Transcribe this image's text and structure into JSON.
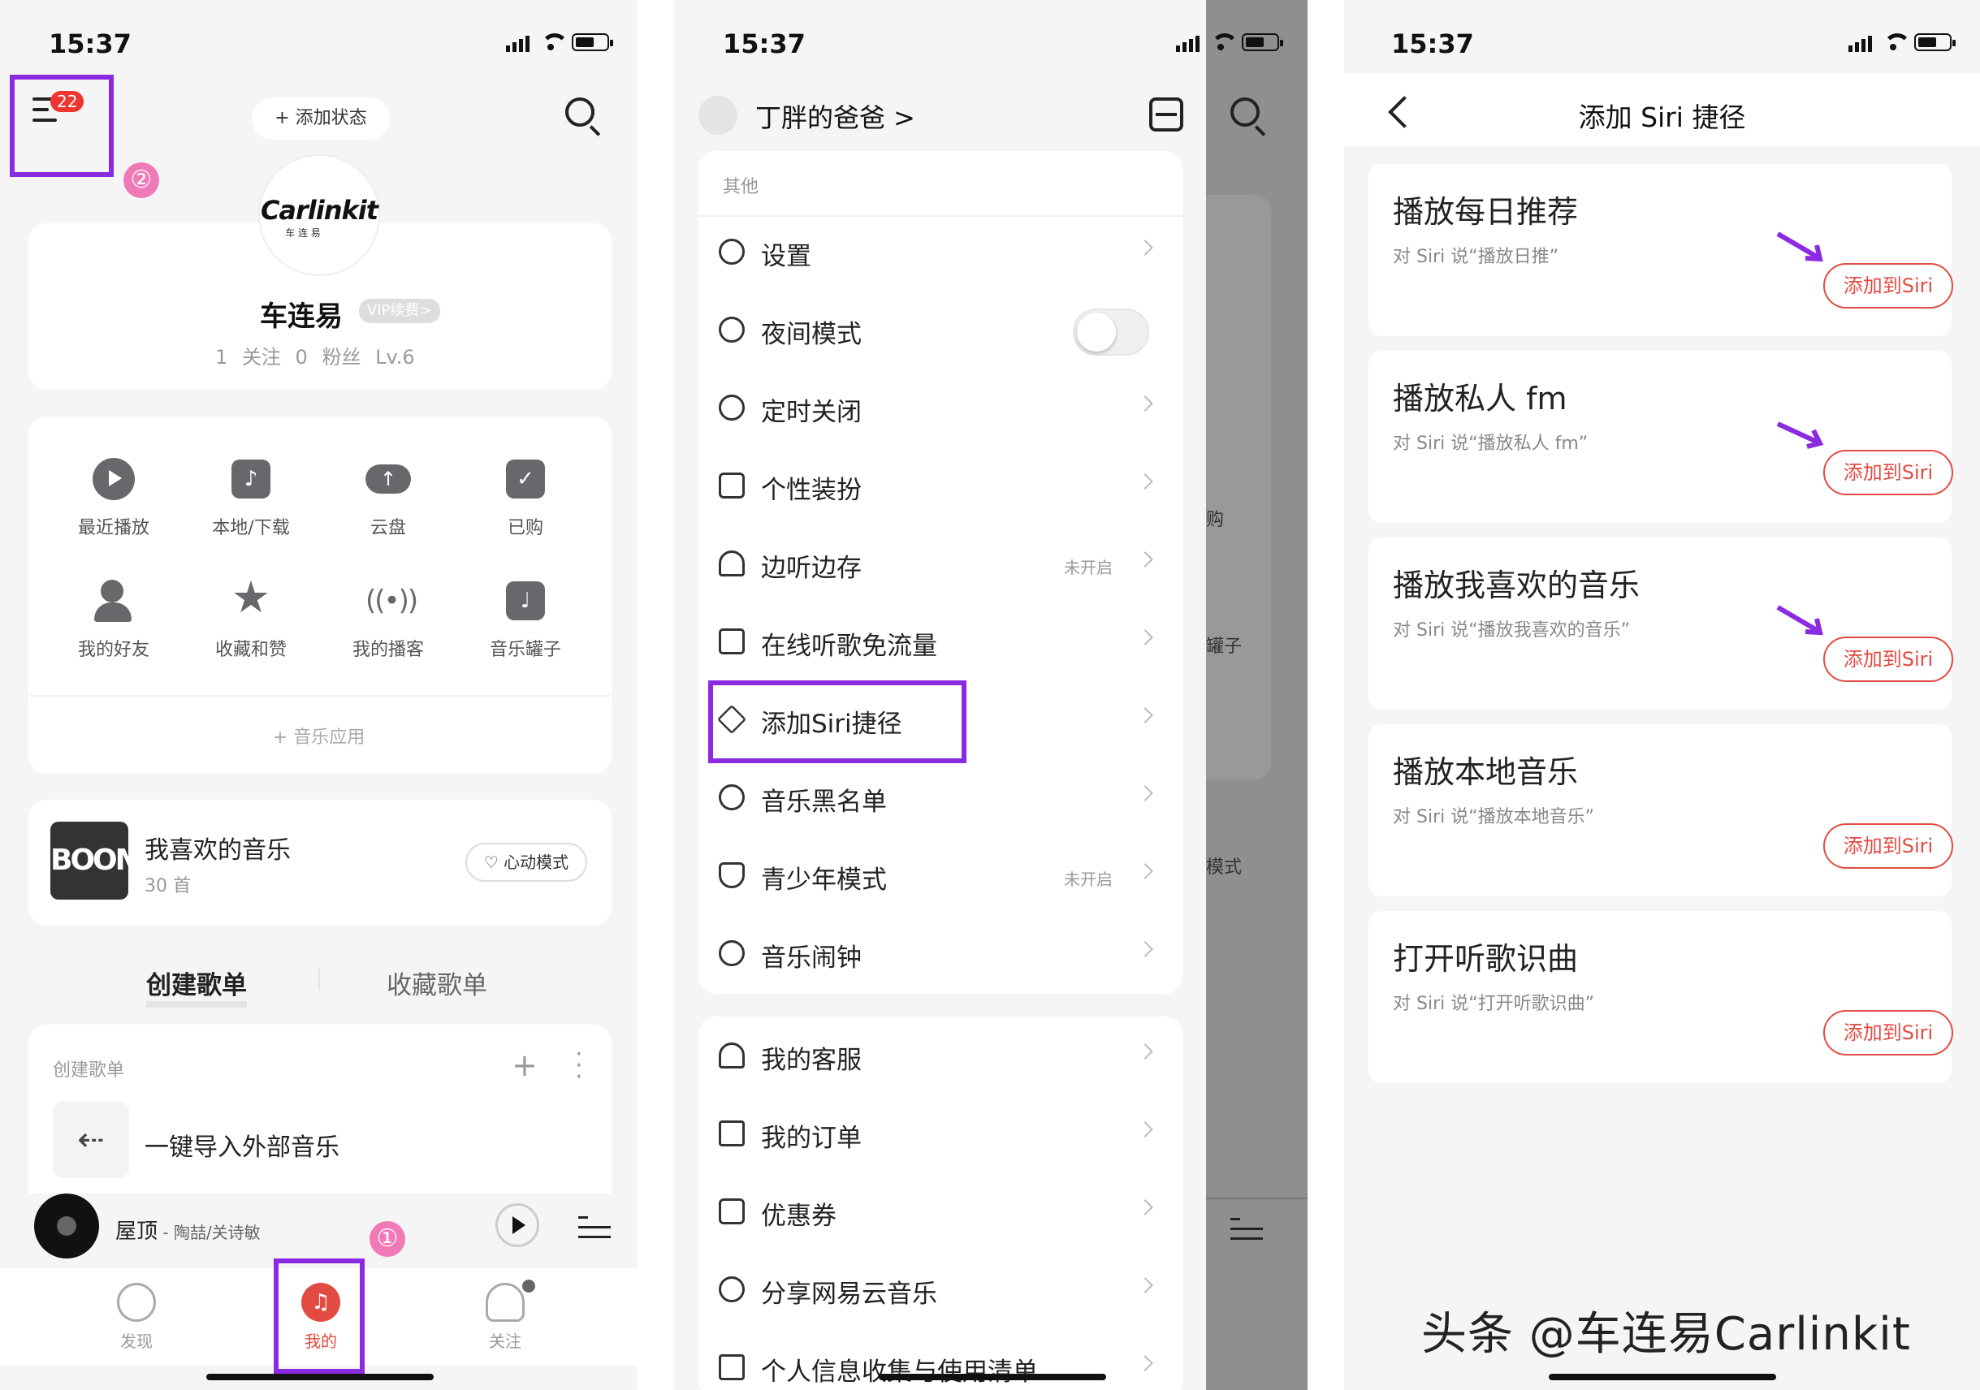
{
  "status": {
    "time": "15:37"
  },
  "panel1": {
    "badge": "22",
    "add_status": "+ 添加状态",
    "profile": {
      "name": "车连易",
      "vip": "VIP续费>",
      "follows": "1 关注",
      "fans": "0 粉丝",
      "level": "Lv.6",
      "logo_main": "Carlinkit",
      "logo_sub": "车 连 易"
    },
    "quick_items": [
      {
        "label": "最近播放",
        "icon": "play-icon"
      },
      {
        "label": "本地/下载",
        "icon": "music-note-icon"
      },
      {
        "label": "云盘",
        "icon": "cloud-upload-icon"
      },
      {
        "label": "已购",
        "icon": "shopping-bag-icon"
      },
      {
        "label": "我的好友",
        "icon": "friends-icon"
      },
      {
        "label": "收藏和赞",
        "icon": "star-icon"
      },
      {
        "label": "我的播客",
        "icon": "podcast-icon"
      },
      {
        "label": "音乐罐子",
        "icon": "jar-icon"
      }
    ],
    "music_apps": "+ 音乐应用",
    "liked": {
      "title": "我喜欢的音乐",
      "count": "30 首",
      "heart_mode": "心动模式",
      "cover_text": "BOOM"
    },
    "tabs": [
      "创建歌单",
      "收藏歌单"
    ],
    "playlist_section": "创建歌单",
    "import_label": "一键导入外部音乐",
    "now_playing": {
      "song": "屋顶",
      "artist": " - 陶喆/关诗敏"
    },
    "nav": [
      "发现",
      "我的",
      "关注"
    ],
    "marker_menu": "②",
    "marker_nav": "①"
  },
  "panel2": {
    "user": "丁胖的爸爸 >",
    "section_other": "其他",
    "menu": [
      {
        "label": "设置",
        "icon": "settings-icon",
        "value": ""
      },
      {
        "label": "夜间模式",
        "icon": "moon-icon",
        "value": "",
        "toggle": true
      },
      {
        "label": "定时关闭",
        "icon": "timer-icon",
        "value": ""
      },
      {
        "label": "个性装扮",
        "icon": "tshirt-icon",
        "value": ""
      },
      {
        "label": "边听边存",
        "icon": "headphones-icon",
        "value": "未开启"
      },
      {
        "label": "在线听歌免流量",
        "icon": "sim-card-icon",
        "value": ""
      },
      {
        "label": "添加Siri捷径",
        "icon": "layers-icon",
        "value": ""
      },
      {
        "label": "音乐黑名单",
        "icon": "block-icon",
        "value": ""
      },
      {
        "label": "青少年模式",
        "icon": "shield-icon",
        "value": "未开启"
      },
      {
        "label": "音乐闹钟",
        "icon": "alarm-icon",
        "value": ""
      }
    ],
    "menu2": [
      {
        "label": "我的客服",
        "icon": "headset-icon"
      },
      {
        "label": "我的订单",
        "icon": "order-icon"
      },
      {
        "label": "优惠券",
        "icon": "coupon-icon"
      },
      {
        "label": "分享网易云音乐",
        "icon": "share-icon"
      },
      {
        "label": "个人信息收集与使用清单",
        "icon": "document-icon"
      }
    ],
    "bg_hints": {
      "a": "购",
      "b": "罐子",
      "c": "模式"
    }
  },
  "panel3": {
    "title": "添加 Siri 捷径",
    "button_label": "添加到Siri",
    "items": [
      {
        "title": "播放每日推荐",
        "sub": "对 Siri 说“播放日推”"
      },
      {
        "title": "播放私人 fm",
        "sub": "对 Siri 说“播放私人 fm”"
      },
      {
        "title": "播放我喜欢的音乐",
        "sub": "对 Siri 说“播放我喜欢的音乐”"
      },
      {
        "title": "播放本地音乐",
        "sub": "对 Siri 说“播放本地音乐”"
      },
      {
        "title": "打开听歌识曲",
        "sub": "对 Siri 说“打开听歌识曲”"
      }
    ],
    "watermark": "头条 @车连易Carlinkit"
  },
  "colors": {
    "accent_red": "#e24b42",
    "highlight_purple": "#8a2be2",
    "marker_pink": "#f07ab8"
  }
}
